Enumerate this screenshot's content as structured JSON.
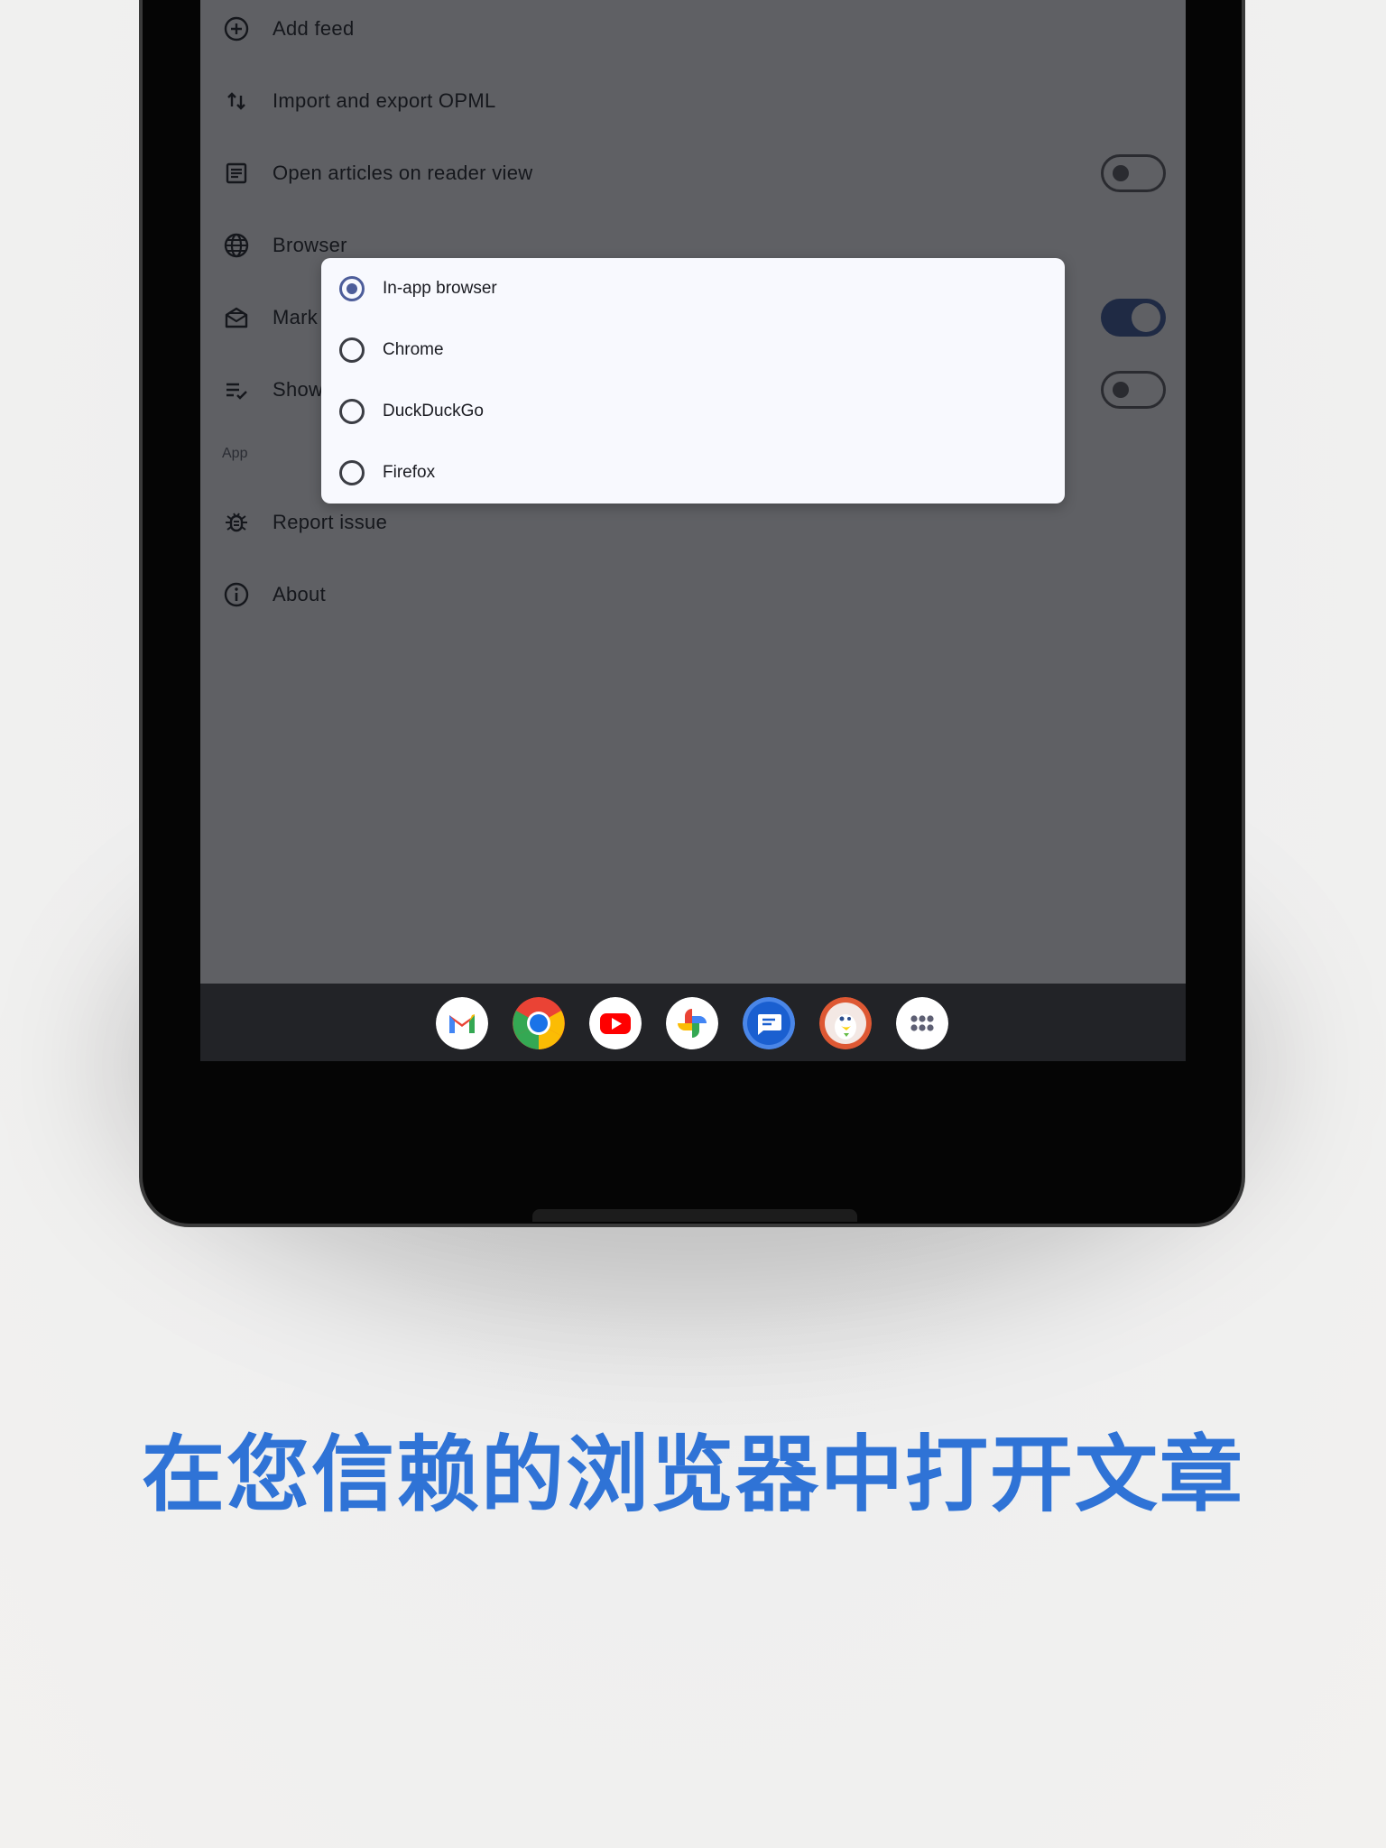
{
  "settings": {
    "rows": [
      {
        "label": "Add feed",
        "icon": "add-circle-icon"
      },
      {
        "label": "Import and export OPML",
        "icon": "swap-vertical-icon"
      },
      {
        "label": "Open articles on reader view",
        "icon": "article-icon",
        "toggle": "off"
      },
      {
        "label": "Browser",
        "icon": "globe-icon"
      },
      {
        "label": "Mark",
        "icon": "mark-read-icon",
        "toggle": "on"
      },
      {
        "label": "Show",
        "icon": "checklist-icon",
        "toggle": "off"
      }
    ],
    "section_app": "App",
    "app_rows": [
      {
        "label": "Report issue",
        "icon": "bug-icon"
      },
      {
        "label": "About",
        "icon": "info-icon"
      }
    ]
  },
  "browser_dialog": {
    "options": [
      "In-app browser",
      "Chrome",
      "DuckDuckGo",
      "Firefox"
    ],
    "selected": "In-app browser"
  },
  "dock": {
    "apps": [
      "gmail-icon",
      "chrome-icon",
      "youtube-icon",
      "photos-icon",
      "messages-icon",
      "duckduckgo-icon",
      "app-drawer-icon"
    ]
  },
  "caption": "在您信赖的浏览器中打开文章",
  "colors": {
    "caption": "#2f73d6",
    "screen_scrim": "#5f6064",
    "dialog_bg": "#f8f9fe",
    "radio_accent": "#4d5d9a",
    "toggle_on": "#1f2a44"
  }
}
